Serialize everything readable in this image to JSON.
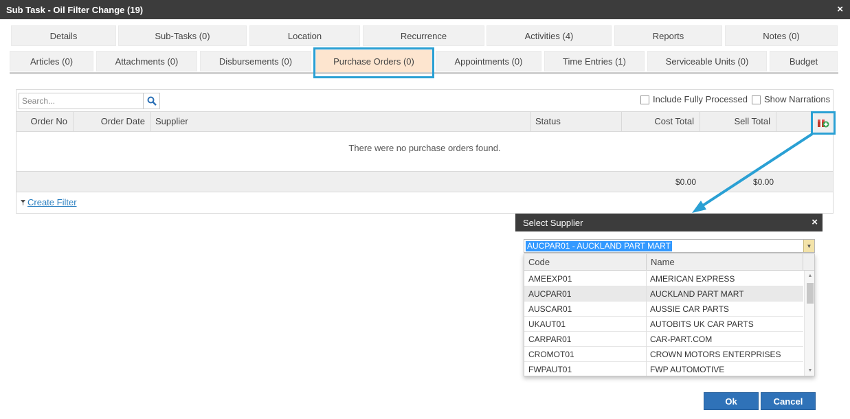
{
  "window": {
    "title": "Sub Task - Oil Filter Change (19)",
    "close": "×"
  },
  "tabs_row1": [
    {
      "label": "Details"
    },
    {
      "label": "Sub-Tasks (0)"
    },
    {
      "label": "Location"
    },
    {
      "label": "Recurrence"
    },
    {
      "label": "Activities (4)"
    },
    {
      "label": "Reports"
    },
    {
      "label": "Notes (0)"
    }
  ],
  "tabs_row2": [
    {
      "label": "Articles (0)"
    },
    {
      "label": "Attachments (0)"
    },
    {
      "label": "Disbursements (0)"
    },
    {
      "label": "Purchase Orders (0)",
      "active": true
    },
    {
      "label": "Appointments (0)"
    },
    {
      "label": "Time Entries (1)"
    },
    {
      "label": "Serviceable Units (0)"
    },
    {
      "label": "Budget"
    }
  ],
  "toolbar": {
    "search_placeholder": "Search...",
    "include_fully_processed": "Include Fully Processed",
    "show_narrations": "Show Narrations"
  },
  "grid": {
    "columns": [
      "Order No",
      "Order Date",
      "Supplier",
      "Status",
      "Cost Total",
      "Sell Total"
    ],
    "empty_message": "There were no purchase orders found.",
    "cost_total": "$0.00",
    "sell_total": "$0.00"
  },
  "create_filter": "Create Filter",
  "dialog": {
    "title": "Select Supplier",
    "close": "×",
    "selected_value": "AUCPAR01 - AUCKLAND PART MART",
    "columns": [
      "Code",
      "Name"
    ],
    "rows": [
      {
        "code": "AMEEXP01",
        "name": "AMERICAN EXPRESS"
      },
      {
        "code": "AUCPAR01",
        "name": "AUCKLAND PART MART",
        "selected": true
      },
      {
        "code": "AUSCAR01",
        "name": "AUSSIE CAR PARTS"
      },
      {
        "code": "UKAUT01",
        "name": "AUTOBITS UK CAR PARTS"
      },
      {
        "code": "CARPAR01",
        "name": "CAR-PART.COM"
      },
      {
        "code": "CROMOT01",
        "name": "CROWN MOTORS ENTERPRISES"
      },
      {
        "code": "FWPAUT01",
        "name": "FWP AUTOMOTIVE"
      }
    ],
    "ok_label": "Ok",
    "cancel_label": "Cancel"
  },
  "colors": {
    "highlight": "#2aa0d4",
    "active_tab": "#fde5cf",
    "active_tab_border": "#f0a060",
    "button": "#2f72b8",
    "titlebar": "#3c3c3c"
  },
  "icons": {
    "search": "search-icon",
    "add": "add-supplier-icon",
    "filter": "filter-icon",
    "close": "close-icon"
  }
}
